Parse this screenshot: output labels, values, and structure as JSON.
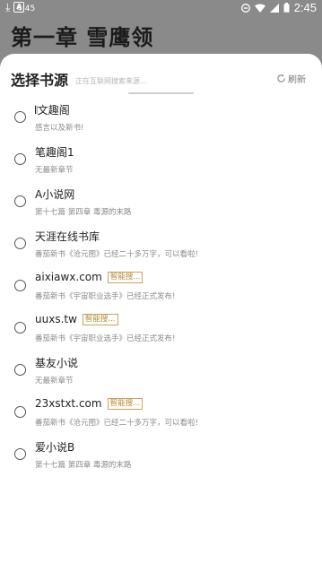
{
  "status_bar": {
    "small_time": "4:45",
    "time": "2:45"
  },
  "background": {
    "chapter_title": "第一章 雪鹰领"
  },
  "sheet": {
    "title": "选择书源",
    "hint": "正在互联网搜索来源...",
    "refresh_label": "刷新"
  },
  "sources": [
    {
      "name": "𝄃文趣阁",
      "badge": "",
      "latest": "感言以及新书!"
    },
    {
      "name": "笔趣阁1",
      "badge": "",
      "latest": "无最新章节"
    },
    {
      "name": "A小说网",
      "badge": "",
      "latest": "第十七篇 第四章 毒源的末路"
    },
    {
      "name": "天涯在线书库",
      "badge": "",
      "latest": "番茄新书《沧元图》已经二十多万字，可以看啦!"
    },
    {
      "name": "aixiawx.com",
      "badge": "智能搜...",
      "latest": "番茄新书《宇宙职业选手》已经正式发布!"
    },
    {
      "name": "uuxs.tw",
      "badge": "智能搜...",
      "latest": "番茄新书《宇宙职业选手》已经正式发布!"
    },
    {
      "name": "基友小说",
      "badge": "",
      "latest": "无最新章节"
    },
    {
      "name": "23xstxt.com",
      "badge": "智能搜...",
      "latest": "番茄新书《沧元图》已经二十多万字，可以看啦!"
    },
    {
      "name": "爱小说B",
      "badge": "",
      "latest": "第十七篇 第四章 毒源的末路"
    }
  ],
  "colors": {
    "overlay": "#8a8a8a",
    "sheet": "#ffffff",
    "badge": "#b48a3a"
  }
}
